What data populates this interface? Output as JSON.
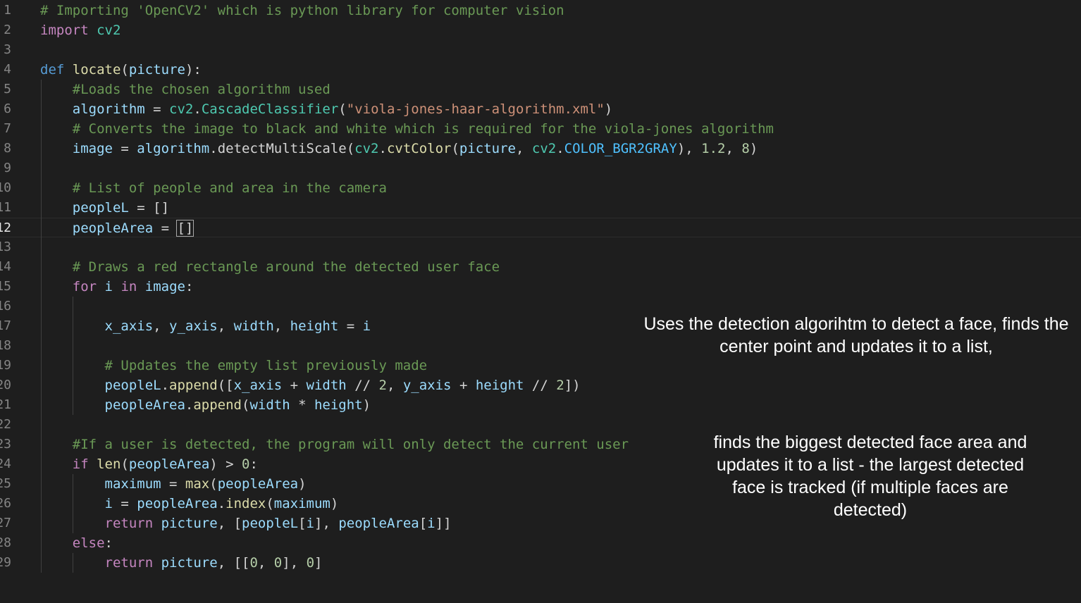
{
  "editor": {
    "active_line": 12,
    "lines": [
      {
        "n": "1",
        "tokens": [
          [
            "c",
            "# Importing 'OpenCV2' which is python library for computer vision"
          ]
        ]
      },
      {
        "n": "2",
        "tokens": [
          [
            "k",
            "import"
          ],
          [
            "p",
            " "
          ],
          [
            "m",
            "cv2"
          ]
        ]
      },
      {
        "n": "3",
        "tokens": []
      },
      {
        "n": "4",
        "tokens": [
          [
            "d",
            "def"
          ],
          [
            "p",
            " "
          ],
          [
            "f",
            "locate"
          ],
          [
            "p",
            "("
          ],
          [
            "v",
            "picture"
          ],
          [
            "p",
            "):"
          ]
        ]
      },
      {
        "n": "5",
        "tokens": [
          [
            "p",
            "    "
          ],
          [
            "c",
            "#Loads the chosen algorithm used"
          ]
        ]
      },
      {
        "n": "6",
        "tokens": [
          [
            "p",
            "    "
          ],
          [
            "v",
            "algorithm"
          ],
          [
            "p",
            " = "
          ],
          [
            "m",
            "cv2"
          ],
          [
            "p",
            "."
          ],
          [
            "m",
            "CascadeClassifier"
          ],
          [
            "p",
            "("
          ],
          [
            "s",
            "\"viola-jones-haar-algorithm.xml\""
          ],
          [
            "p",
            ")"
          ]
        ]
      },
      {
        "n": "7",
        "tokens": [
          [
            "p",
            "    "
          ],
          [
            "c",
            "# Converts the image to black and white which is required for the viola-jones algorithm"
          ]
        ]
      },
      {
        "n": "8",
        "tokens": [
          [
            "p",
            "    "
          ],
          [
            "v",
            "image"
          ],
          [
            "p",
            " = "
          ],
          [
            "v",
            "algorithm"
          ],
          [
            "p",
            ".detectMultiScale("
          ],
          [
            "m",
            "cv2"
          ],
          [
            "p",
            "."
          ],
          [
            "f",
            "cvtColor"
          ],
          [
            "p",
            "("
          ],
          [
            "v",
            "picture"
          ],
          [
            "p",
            ", "
          ],
          [
            "m",
            "cv2"
          ],
          [
            "p",
            "."
          ],
          [
            "cn",
            "COLOR_BGR2GRAY"
          ],
          [
            "p",
            "), "
          ],
          [
            "n",
            "1.2"
          ],
          [
            "p",
            ", "
          ],
          [
            "n",
            "8"
          ],
          [
            "p",
            ")"
          ]
        ]
      },
      {
        "n": "9",
        "tokens": []
      },
      {
        "n": "10",
        "tokens": [
          [
            "p",
            "    "
          ],
          [
            "c",
            "# List of people and area in the camera"
          ]
        ]
      },
      {
        "n": "11",
        "tokens": [
          [
            "p",
            "    "
          ],
          [
            "v",
            "peopleL"
          ],
          [
            "p",
            " = []"
          ]
        ]
      },
      {
        "n": "12",
        "tokens": [
          [
            "p",
            "    "
          ],
          [
            "v",
            "peopleArea"
          ],
          [
            "p",
            " = "
          ],
          [
            "p",
            "[]",
            "cursor"
          ]
        ]
      },
      {
        "n": "13",
        "tokens": []
      },
      {
        "n": "14",
        "tokens": [
          [
            "p",
            "    "
          ],
          [
            "c",
            "# Draws a red rectangle around the detected user face"
          ]
        ]
      },
      {
        "n": "15",
        "tokens": [
          [
            "p",
            "    "
          ],
          [
            "k",
            "for"
          ],
          [
            "p",
            " "
          ],
          [
            "v",
            "i"
          ],
          [
            "p",
            " "
          ],
          [
            "k",
            "in"
          ],
          [
            "p",
            " "
          ],
          [
            "v",
            "image"
          ],
          [
            "p",
            ":"
          ]
        ]
      },
      {
        "n": "16",
        "tokens": []
      },
      {
        "n": "17",
        "tokens": [
          [
            "p",
            "        "
          ],
          [
            "v",
            "x_axis"
          ],
          [
            "p",
            ", "
          ],
          [
            "v",
            "y_axis"
          ],
          [
            "p",
            ", "
          ],
          [
            "v",
            "width"
          ],
          [
            "p",
            ", "
          ],
          [
            "v",
            "height"
          ],
          [
            "p",
            " = "
          ],
          [
            "v",
            "i"
          ]
        ]
      },
      {
        "n": "18",
        "tokens": []
      },
      {
        "n": "19",
        "tokens": [
          [
            "p",
            "        "
          ],
          [
            "c",
            "# Updates the empty list previously made"
          ]
        ]
      },
      {
        "n": "20",
        "tokens": [
          [
            "p",
            "        "
          ],
          [
            "v",
            "peopleL"
          ],
          [
            "p",
            "."
          ],
          [
            "f",
            "append"
          ],
          [
            "p",
            "(["
          ],
          [
            "v",
            "x_axis"
          ],
          [
            "p",
            " + "
          ],
          [
            "v",
            "width"
          ],
          [
            "p",
            " // "
          ],
          [
            "n",
            "2"
          ],
          [
            "p",
            ", "
          ],
          [
            "v",
            "y_axis"
          ],
          [
            "p",
            " + "
          ],
          [
            "v",
            "height"
          ],
          [
            "p",
            " // "
          ],
          [
            "n",
            "2"
          ],
          [
            "p",
            "])"
          ]
        ]
      },
      {
        "n": "21",
        "tokens": [
          [
            "p",
            "        "
          ],
          [
            "v",
            "peopleArea"
          ],
          [
            "p",
            "."
          ],
          [
            "f",
            "append"
          ],
          [
            "p",
            "("
          ],
          [
            "v",
            "width"
          ],
          [
            "p",
            " * "
          ],
          [
            "v",
            "height"
          ],
          [
            "p",
            ")"
          ]
        ]
      },
      {
        "n": "22",
        "tokens": []
      },
      {
        "n": "23",
        "tokens": [
          [
            "p",
            "    "
          ],
          [
            "c",
            "#If a user is detected, the program will only detect the current user"
          ]
        ]
      },
      {
        "n": "24",
        "tokens": [
          [
            "p",
            "    "
          ],
          [
            "k",
            "if"
          ],
          [
            "p",
            " "
          ],
          [
            "f",
            "len"
          ],
          [
            "p",
            "("
          ],
          [
            "v",
            "peopleArea"
          ],
          [
            "p",
            ") > "
          ],
          [
            "n",
            "0"
          ],
          [
            "p",
            ":"
          ]
        ]
      },
      {
        "n": "25",
        "tokens": [
          [
            "p",
            "        "
          ],
          [
            "v",
            "maximum"
          ],
          [
            "p",
            " = "
          ],
          [
            "f",
            "max"
          ],
          [
            "p",
            "("
          ],
          [
            "v",
            "peopleArea"
          ],
          [
            "p",
            ")"
          ]
        ]
      },
      {
        "n": "26",
        "tokens": [
          [
            "p",
            "        "
          ],
          [
            "v",
            "i"
          ],
          [
            "p",
            " = "
          ],
          [
            "v",
            "peopleArea"
          ],
          [
            "p",
            "."
          ],
          [
            "f",
            "index"
          ],
          [
            "p",
            "("
          ],
          [
            "v",
            "maximum"
          ],
          [
            "p",
            ")"
          ]
        ]
      },
      {
        "n": "27",
        "tokens": [
          [
            "p",
            "        "
          ],
          [
            "k",
            "return"
          ],
          [
            "p",
            " "
          ],
          [
            "v",
            "picture"
          ],
          [
            "p",
            ", ["
          ],
          [
            "v",
            "peopleL"
          ],
          [
            "p",
            "["
          ],
          [
            "v",
            "i"
          ],
          [
            "p",
            "], "
          ],
          [
            "v",
            "peopleArea"
          ],
          [
            "p",
            "["
          ],
          [
            "v",
            "i"
          ],
          [
            "p",
            "]]"
          ]
        ]
      },
      {
        "n": "28",
        "tokens": [
          [
            "p",
            "    "
          ],
          [
            "k",
            "else"
          ],
          [
            "p",
            ":"
          ]
        ]
      },
      {
        "n": "29",
        "tokens": [
          [
            "p",
            "        "
          ],
          [
            "k",
            "return"
          ],
          [
            "p",
            " "
          ],
          [
            "v",
            "picture"
          ],
          [
            "p",
            ", [["
          ],
          [
            "n",
            "0"
          ],
          [
            "p",
            ", "
          ],
          [
            "n",
            "0"
          ],
          [
            "p",
            "], "
          ],
          [
            "n",
            "0"
          ],
          [
            "p",
            "]"
          ]
        ]
      }
    ]
  },
  "annotations": {
    "note1": "Uses the detection algorihtm to detect a face, finds the center point and updates it to a list,",
    "note2": "finds the biggest detected face area and updates it to a list - the largest detected face is tracked (if multiple faces are detected)"
  }
}
